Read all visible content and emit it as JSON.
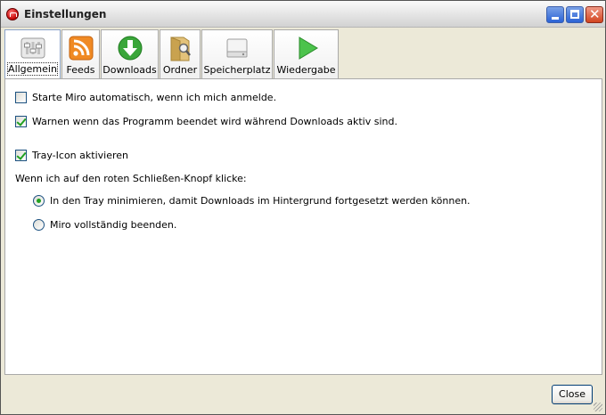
{
  "window": {
    "title": "Einstellungen"
  },
  "tabs": [
    {
      "label": "Allgemein",
      "icon": "general-settings-icon",
      "selected": true
    },
    {
      "label": "Feeds",
      "icon": "rss-feed-icon",
      "selected": false
    },
    {
      "label": "Downloads",
      "icon": "download-arrow-icon",
      "selected": false
    },
    {
      "label": "Ordner",
      "icon": "folder-search-icon",
      "selected": false
    },
    {
      "label": "Speicherplatz",
      "icon": "hard-drive-icon",
      "selected": false
    },
    {
      "label": "Wiedergabe",
      "icon": "play-icon",
      "selected": false
    }
  ],
  "general": {
    "autostart": {
      "label": "Starte Miro automatisch, wenn ich mich anmelde.",
      "checked": false
    },
    "warn_on_quit": {
      "label": "Warnen wenn das Programm beendet wird während Downloads aktiv sind.",
      "checked": true
    },
    "tray_icon": {
      "label": "Tray-Icon aktivieren",
      "checked": true
    },
    "close_prompt": "Wenn ich auf den roten Schließen-Knopf klicke:",
    "close_options": [
      {
        "label": "In den Tray minimieren, damit Downloads im Hintergrund fortgesetzt werden können.",
        "selected": true
      },
      {
        "label": "Miro vollständig beenden.",
        "selected": false
      }
    ]
  },
  "footer": {
    "close_label": "Close"
  },
  "colors": {
    "accent_check": "#21a121",
    "feed_orange": "#f08a24",
    "download_green": "#3aa63a"
  }
}
